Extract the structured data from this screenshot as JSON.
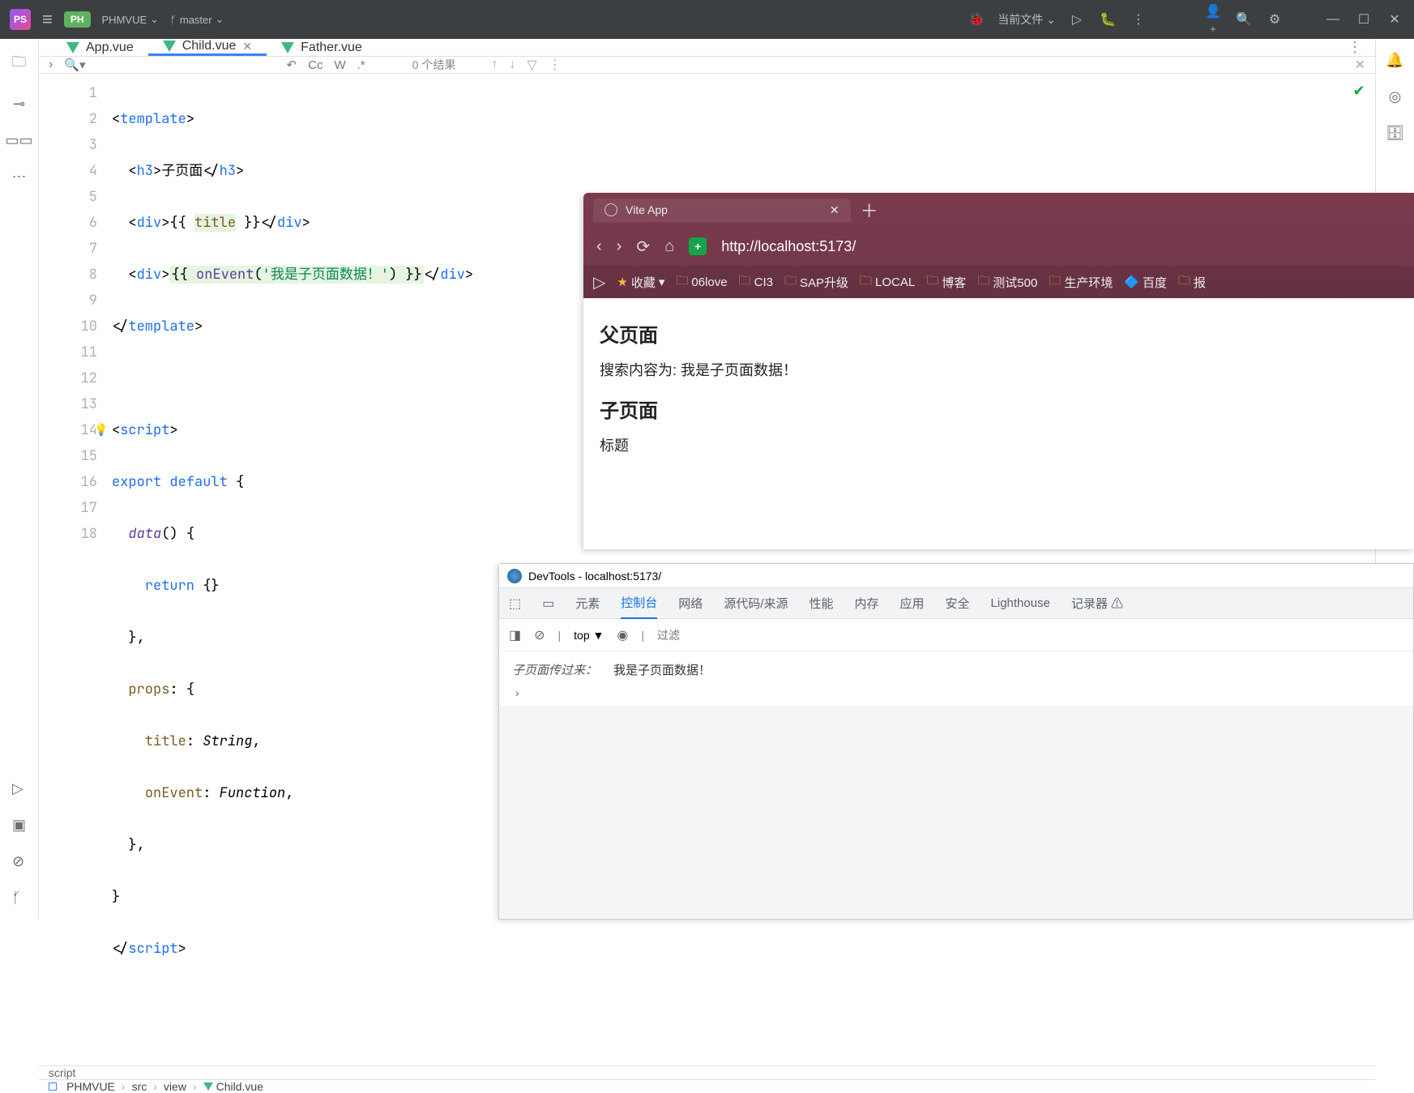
{
  "titlebar": {
    "project_badge": "PH",
    "project_name": "PHMVUE",
    "branch": "master",
    "run_config": "当前文件"
  },
  "tabs": [
    {
      "label": "App.vue",
      "active": false
    },
    {
      "label": "Child.vue",
      "active": true
    },
    {
      "label": "Father.vue",
      "active": false
    }
  ],
  "findbar": {
    "results": "0 个结果",
    "case": "Cc",
    "word": "W",
    "regex": ".*"
  },
  "code": {
    "lines": [
      "<template>",
      "  <h3>子页面</h3>",
      "  <div>{{ title }}</div>",
      "  <div>{{ onEvent('我是子页面数据！') }}</div>",
      "</template>",
      "",
      "<script>",
      "export default {",
      "  data() {",
      "    return {}",
      "  },",
      "  props: {",
      "    title: String,",
      "    onEvent: Function,",
      "  },",
      "}",
      "</script>",
      ""
    ]
  },
  "status_crumb": "script",
  "breadcrumb": [
    "PHMVUE",
    "src",
    "view",
    "Child.vue"
  ],
  "browser": {
    "tab_title": "Vite App",
    "url": "http://localhost:5173/",
    "fav_label": "收藏",
    "bookmarks": [
      "06love",
      "CI3",
      "SAP升级",
      "LOCAL",
      "博客",
      "测试500",
      "生产环境",
      "百度",
      "报"
    ],
    "page": {
      "h1": "父页面",
      "p1": "搜索内容为: 我是子页面数据！",
      "h2": "子页面",
      "p2": "标题"
    }
  },
  "devtools": {
    "title": "DevTools - localhost:5173/",
    "tabs": [
      "元素",
      "控制台",
      "网络",
      "源代码/来源",
      "性能",
      "内存",
      "应用",
      "安全",
      "Lighthouse",
      "记录器 ⚠"
    ],
    "active_tab": "控制台",
    "ctx": "top",
    "filter_placeholder": "过滤",
    "log": {
      "label": "子页面传过来：",
      "msg": "我是子页面数据！"
    }
  }
}
